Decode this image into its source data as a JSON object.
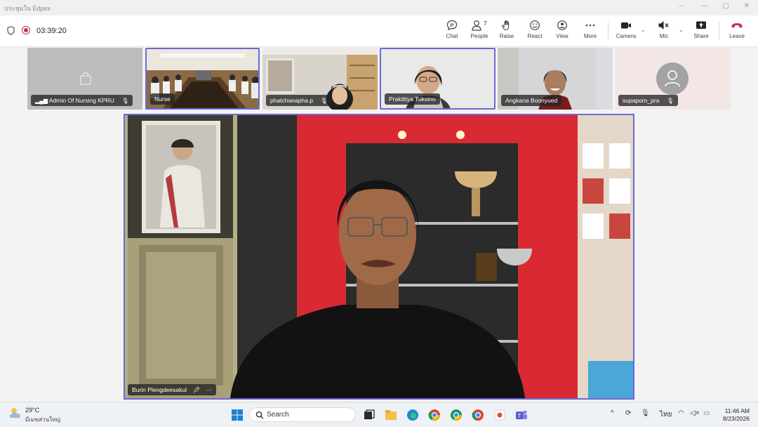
{
  "window": {
    "title": "ประชุมใน Edpex"
  },
  "meeting": {
    "elapsed": "03:39:20",
    "toolbar": [
      {
        "id": "chat",
        "label": "Chat",
        "icon": "chat-icon"
      },
      {
        "id": "people",
        "label": "People",
        "icon": "people-icon",
        "count": "7"
      },
      {
        "id": "raise",
        "label": "Raise",
        "icon": "hand-icon"
      },
      {
        "id": "react",
        "label": "React",
        "icon": "smiley-icon"
      },
      {
        "id": "view",
        "label": "View",
        "icon": "view-icon"
      },
      {
        "id": "more",
        "label": "More",
        "icon": "more-icon"
      },
      {
        "id": "camera",
        "label": "Camera",
        "icon": "camera-icon"
      },
      {
        "id": "mic",
        "label": "Mic",
        "icon": "mic-muted-icon"
      },
      {
        "id": "share",
        "label": "Share",
        "icon": "share-icon"
      },
      {
        "id": "leave",
        "label": "Leave",
        "icon": "phone-hangup-icon"
      }
    ],
    "participants": [
      {
        "name": "Admin Of Nursing KPRU",
        "muted": true
      },
      {
        "name": "Nurse",
        "muted": false
      },
      {
        "name": "phatchanapha.p",
        "muted": true
      },
      {
        "name": "Prakittiya Tuksino",
        "muted": false
      },
      {
        "name": "Angkana Boonyued",
        "muted": false
      },
      {
        "name": "supaporn_pra",
        "muted": true
      }
    ],
    "speaker": {
      "name": "Burin Plengdeesakul"
    }
  },
  "taskbar": {
    "weather": {
      "temp": "29°C",
      "desc": "มีเมฆส่วนใหญ่"
    },
    "search_label": "Search",
    "lang": "ไทย",
    "time": "11:46 AM",
    "date": "8/23/2026"
  },
  "colors": {
    "accent": "#6b69d6",
    "leave": "#c4314b"
  }
}
